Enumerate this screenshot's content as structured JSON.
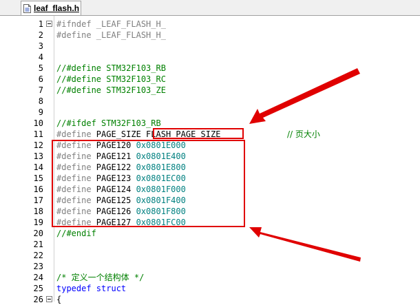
{
  "tab": {
    "label": "leaf_flash.h"
  },
  "lines": [
    {
      "n": "1",
      "fold": true,
      "segments": [
        {
          "t": "#ifndef _LEAF_FLASH_H_",
          "c": "pp"
        }
      ]
    },
    {
      "n": "2",
      "fold": false,
      "segments": [
        {
          "t": "#define _LEAF_FLASH_H_",
          "c": "pp"
        }
      ]
    },
    {
      "n": "3",
      "fold": false,
      "segments": []
    },
    {
      "n": "4",
      "fold": false,
      "segments": []
    },
    {
      "n": "5",
      "fold": false,
      "segments": [
        {
          "t": "//#define STM32F103_RB",
          "c": "cm"
        }
      ]
    },
    {
      "n": "6",
      "fold": false,
      "segments": [
        {
          "t": "//#define STM32F103_RC",
          "c": "cm"
        }
      ]
    },
    {
      "n": "7",
      "fold": false,
      "segments": [
        {
          "t": "//#define STM32F103_ZE",
          "c": "cm"
        }
      ]
    },
    {
      "n": "8",
      "fold": false,
      "segments": []
    },
    {
      "n": "9",
      "fold": false,
      "segments": []
    },
    {
      "n": "10",
      "fold": false,
      "segments": [
        {
          "t": "//#ifdef STM32F103_RB",
          "c": "cm"
        }
      ]
    },
    {
      "n": "11",
      "fold": false,
      "segments": [
        {
          "t": "#define ",
          "c": "pp"
        },
        {
          "t": "PAGE_SIZE FLASH_PAGE_SIZE",
          "c": ""
        }
      ]
    },
    {
      "n": "12",
      "fold": false,
      "segments": [
        {
          "t": "#define ",
          "c": "pp"
        },
        {
          "t": "PAGE120 ",
          "c": ""
        },
        {
          "t": "0x0801E000",
          "c": "hex"
        }
      ]
    },
    {
      "n": "13",
      "fold": false,
      "segments": [
        {
          "t": "#define ",
          "c": "pp"
        },
        {
          "t": "PAGE121 ",
          "c": ""
        },
        {
          "t": "0x0801E400",
          "c": "hex"
        }
      ]
    },
    {
      "n": "14",
      "fold": false,
      "segments": [
        {
          "t": "#define ",
          "c": "pp"
        },
        {
          "t": "PAGE122 ",
          "c": ""
        },
        {
          "t": "0x0801E800",
          "c": "hex"
        }
      ]
    },
    {
      "n": "15",
      "fold": false,
      "segments": [
        {
          "t": "#define ",
          "c": "pp"
        },
        {
          "t": "PAGE123 ",
          "c": ""
        },
        {
          "t": "0x0801EC00",
          "c": "hex"
        }
      ]
    },
    {
      "n": "16",
      "fold": false,
      "segments": [
        {
          "t": "#define ",
          "c": "pp"
        },
        {
          "t": "PAGE124 ",
          "c": ""
        },
        {
          "t": "0x0801F000",
          "c": "hex"
        }
      ]
    },
    {
      "n": "17",
      "fold": false,
      "segments": [
        {
          "t": "#define ",
          "c": "pp"
        },
        {
          "t": "PAGE125 ",
          "c": ""
        },
        {
          "t": "0x0801F400",
          "c": "hex"
        }
      ]
    },
    {
      "n": "18",
      "fold": false,
      "segments": [
        {
          "t": "#define ",
          "c": "pp"
        },
        {
          "t": "PAGE126 ",
          "c": ""
        },
        {
          "t": "0x0801F800",
          "c": "hex"
        }
      ]
    },
    {
      "n": "19",
      "fold": false,
      "segments": [
        {
          "t": "#define ",
          "c": "pp"
        },
        {
          "t": "PAGE127 ",
          "c": ""
        },
        {
          "t": "0x0801FC00",
          "c": "hex"
        }
      ]
    },
    {
      "n": "20",
      "fold": false,
      "segments": [
        {
          "t": "//#endif",
          "c": "cm"
        }
      ]
    },
    {
      "n": "21",
      "fold": false,
      "segments": []
    },
    {
      "n": "22",
      "fold": false,
      "segments": []
    },
    {
      "n": "23",
      "fold": false,
      "segments": []
    },
    {
      "n": "24",
      "fold": false,
      "segments": [
        {
          "t": "/* 定义一个结构体 */",
          "c": "cm"
        }
      ]
    },
    {
      "n": "25",
      "fold": false,
      "segments": [
        {
          "t": "typedef struct",
          "c": "kw"
        }
      ]
    },
    {
      "n": "26",
      "fold": true,
      "segments": [
        {
          "t": "{",
          "c": ""
        }
      ]
    }
  ],
  "annotation": {
    "comment": "// 页大小"
  },
  "colors": {
    "highlight": "#e00000",
    "comment": "#008000",
    "preprocessor": "#808080",
    "hex": "#008080",
    "keyword": "#0000ff"
  }
}
